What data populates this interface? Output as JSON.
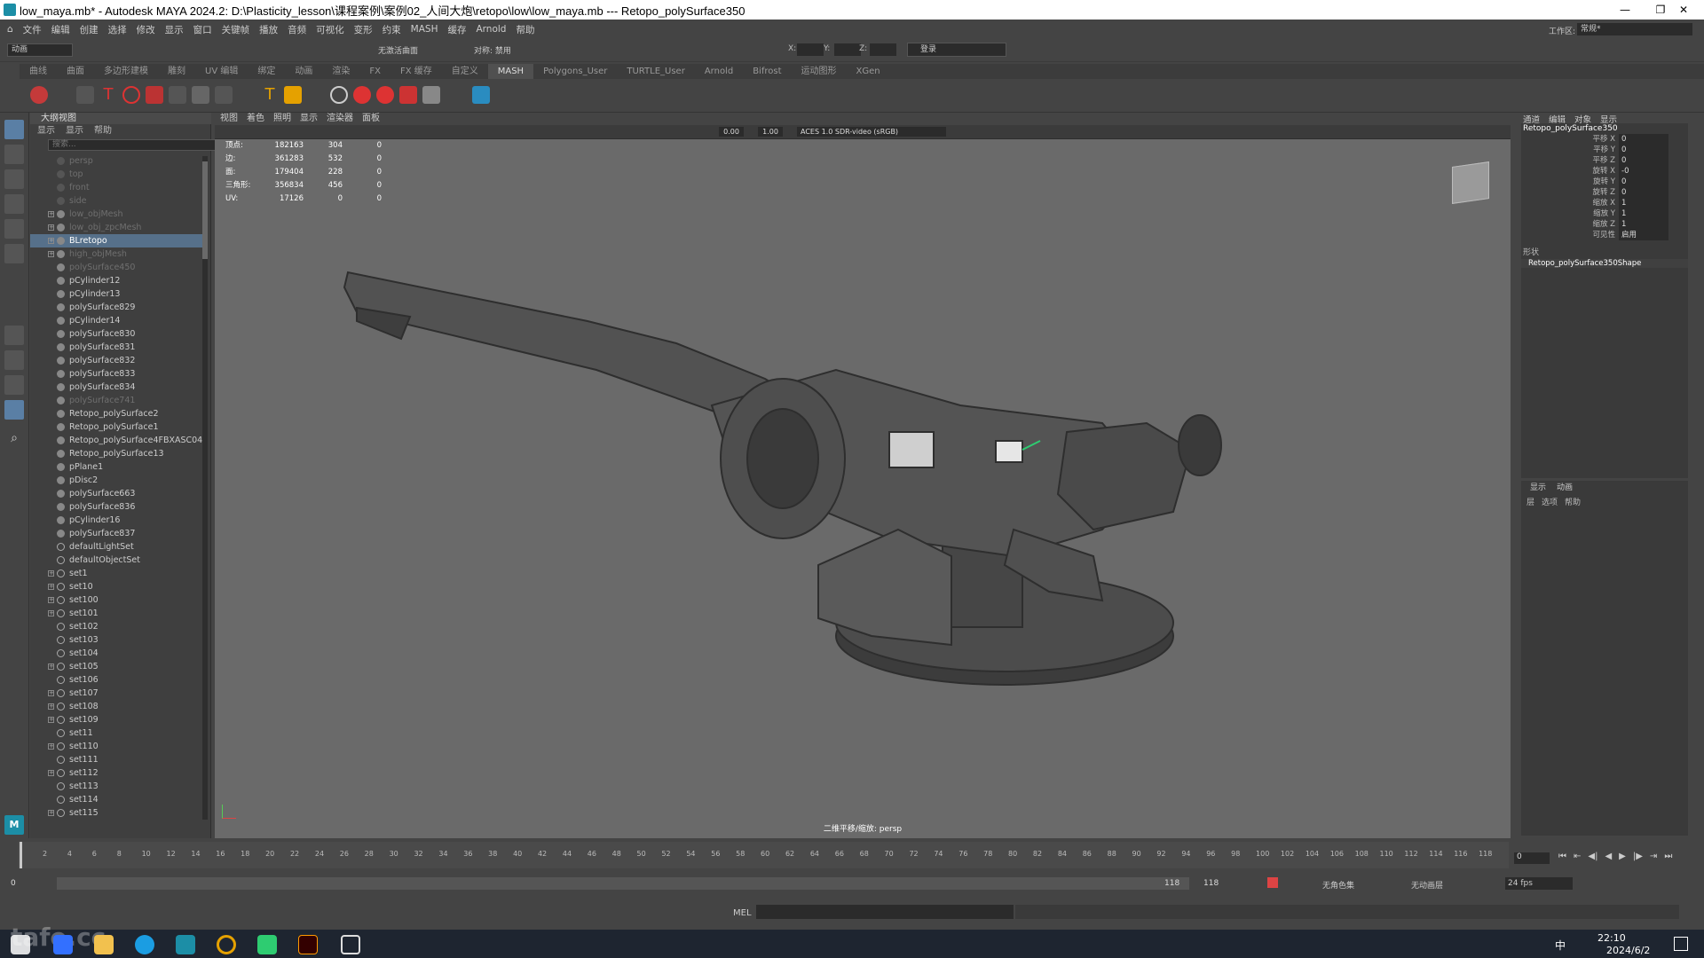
{
  "window": {
    "title": "low_maya.mb* - Autodesk MAYA 2024.2: D:\\Plasticity_lesson\\课程案例\\案例02_人间大炮\\retopo\\low\\low_maya.mb  ---  Retopo_polySurface350",
    "minimize": "—",
    "maximize": "❐",
    "close": "✕"
  },
  "menus": [
    "文件",
    "编辑",
    "创建",
    "选择",
    "修改",
    "显示",
    "窗口",
    "关键帧",
    "播放",
    "音频",
    "可视化",
    "变形",
    "约束",
    "MASH",
    "缓存",
    "Arnold",
    "帮助"
  ],
  "statusline": {
    "mode": "动画",
    "no_live": "无激活曲面",
    "symmetry": "对称: 禁用",
    "x_label": "X:",
    "y_label": "Y:",
    "z_label": "Z:",
    "login": "登录",
    "workspace_label": "工作区:",
    "workspace_value": "常规*"
  },
  "shelf_tabs": [
    "曲线",
    "曲面",
    "多边形建模",
    "雕刻",
    "UV 编辑",
    "绑定",
    "动画",
    "渲染",
    "FX",
    "FX 缓存",
    "自定义",
    "MASH",
    "Polygons_User",
    "TURTLE_User",
    "Arnold",
    "Bifrost",
    "运动图形",
    "XGen"
  ],
  "shelf_active": "MASH",
  "outliner": {
    "header": "大纲视图",
    "menu": [
      "显示",
      "显示",
      "帮助"
    ],
    "search_placeholder": "搜索...",
    "items": [
      {
        "label": "persp",
        "dim": true,
        "exp": false,
        "icon": "camera-icon"
      },
      {
        "label": "top",
        "dim": true,
        "exp": false,
        "icon": "camera-icon"
      },
      {
        "label": "front",
        "dim": true,
        "exp": false,
        "icon": "camera-icon"
      },
      {
        "label": "side",
        "dim": true,
        "exp": false,
        "icon": "camera-icon"
      },
      {
        "label": "low_objMesh",
        "dim": true,
        "exp": true,
        "icon": "mesh-icon"
      },
      {
        "label": "low_obj_zpcMesh",
        "dim": true,
        "exp": true,
        "icon": "mesh-icon"
      },
      {
        "label": "BLretopo",
        "sel": true,
        "exp": true,
        "icon": "mesh-icon"
      },
      {
        "label": "high_objMesh",
        "dim": true,
        "exp": true,
        "icon": "mesh-icon"
      },
      {
        "label": "polySurface450",
        "dim": true,
        "icon": "mesh-icon"
      },
      {
        "label": "pCylinder12",
        "icon": "mesh-icon"
      },
      {
        "label": "pCylinder13",
        "icon": "mesh-icon"
      },
      {
        "label": "polySurface829",
        "icon": "mesh-icon"
      },
      {
        "label": "pCylinder14",
        "icon": "mesh-icon"
      },
      {
        "label": "polySurface830",
        "icon": "mesh-icon"
      },
      {
        "label": "polySurface831",
        "icon": "mesh-icon"
      },
      {
        "label": "polySurface832",
        "icon": "mesh-icon"
      },
      {
        "label": "polySurface833",
        "icon": "mesh-icon"
      },
      {
        "label": "polySurface834",
        "icon": "mesh-icon"
      },
      {
        "label": "polySurface741",
        "dim": true,
        "icon": "mesh-icon"
      },
      {
        "label": "Retopo_polySurface2",
        "icon": "mesh-icon"
      },
      {
        "label": "Retopo_polySurface1",
        "icon": "mesh-icon"
      },
      {
        "label": "Retopo_polySurface4FBXASC0460",
        "icon": "mesh-icon"
      },
      {
        "label": "Retopo_polySurface13",
        "icon": "mesh-icon"
      },
      {
        "label": "pPlane1",
        "icon": "mesh-icon"
      },
      {
        "label": "pDisc2",
        "icon": "mesh-icon"
      },
      {
        "label": "polySurface663",
        "icon": "mesh-icon"
      },
      {
        "label": "polySurface836",
        "icon": "mesh-icon"
      },
      {
        "label": "pCylinder16",
        "icon": "mesh-icon"
      },
      {
        "label": "polySurface837",
        "icon": "mesh-icon"
      },
      {
        "label": "defaultLightSet",
        "icon": "set-icon"
      },
      {
        "label": "defaultObjectSet",
        "icon": "set-icon"
      },
      {
        "label": "set1",
        "exp": true,
        "icon": "set-icon"
      },
      {
        "label": "set10",
        "exp": true,
        "icon": "set-icon"
      },
      {
        "label": "set100",
        "exp": true,
        "icon": "set-icon"
      },
      {
        "label": "set101",
        "exp": true,
        "icon": "set-icon"
      },
      {
        "label": "set102",
        "icon": "set-icon"
      },
      {
        "label": "set103",
        "icon": "set-icon"
      },
      {
        "label": "set104",
        "icon": "set-icon"
      },
      {
        "label": "set105",
        "exp": true,
        "icon": "set-icon"
      },
      {
        "label": "set106",
        "icon": "set-icon"
      },
      {
        "label": "set107",
        "exp": true,
        "icon": "set-icon"
      },
      {
        "label": "set108",
        "exp": true,
        "icon": "set-icon"
      },
      {
        "label": "set109",
        "exp": true,
        "icon": "set-icon"
      },
      {
        "label": "set11",
        "icon": "set-icon"
      },
      {
        "label": "set110",
        "exp": true,
        "icon": "set-icon"
      },
      {
        "label": "set111",
        "icon": "set-icon"
      },
      {
        "label": "set112",
        "exp": true,
        "icon": "set-icon"
      },
      {
        "label": "set113",
        "icon": "set-icon"
      },
      {
        "label": "set114",
        "icon": "set-icon"
      },
      {
        "label": "set115",
        "exp": true,
        "icon": "set-icon"
      }
    ]
  },
  "viewport": {
    "menu": [
      "视图",
      "着色",
      "照明",
      "显示",
      "渲染器",
      "面板"
    ],
    "exposure": "0.00",
    "gamma": "1.00",
    "colorspace": "ACES 1.0 SDR-video (sRGB)",
    "camera_label": "二维平移/缩放: persp",
    "hud": [
      {
        "name": "顶点:",
        "a": "182163",
        "b": "304",
        "c": "0"
      },
      {
        "name": "边:",
        "a": "361283",
        "b": "532",
        "c": "0"
      },
      {
        "name": "面:",
        "a": "179404",
        "b": "228",
        "c": "0"
      },
      {
        "name": "三角形:",
        "a": "356834",
        "b": "456",
        "c": "0"
      },
      {
        "name": "UV:",
        "a": "17126",
        "b": "0",
        "c": "0"
      }
    ]
  },
  "channelbox": {
    "tabs": [
      "通道",
      "编辑",
      "对象",
      "显示"
    ],
    "object": "Retopo_polySurface350",
    "channels": [
      {
        "n": "平移 X",
        "v": "0"
      },
      {
        "n": "平移 Y",
        "v": "0"
      },
      {
        "n": "平移 Z",
        "v": "0"
      },
      {
        "n": "旋转 X",
        "v": "-0"
      },
      {
        "n": "旋转 Y",
        "v": "0"
      },
      {
        "n": "旋转 Z",
        "v": "0"
      },
      {
        "n": "缩放 X",
        "v": "1"
      },
      {
        "n": "缩放 Y",
        "v": "1"
      },
      {
        "n": "缩放 Z",
        "v": "1"
      },
      {
        "n": "可见性",
        "v": "启用"
      }
    ],
    "shapes_label": "形状",
    "shape": "Retopo_polySurface350Shape"
  },
  "layers": {
    "tabs": [
      "显示",
      "动画"
    ],
    "menu": [
      "层",
      "选项",
      "帮助"
    ]
  },
  "timeline": {
    "ticks": [
      "2",
      "4",
      "6",
      "8",
      "10",
      "12",
      "14",
      "16",
      "18",
      "20",
      "22",
      "24",
      "26",
      "28",
      "30",
      "32",
      "34",
      "36",
      "38",
      "40",
      "42",
      "44",
      "46",
      "48",
      "50",
      "52",
      "54",
      "56",
      "58",
      "60",
      "62",
      "64",
      "66",
      "68",
      "70",
      "72",
      "74",
      "76",
      "78",
      "80",
      "82",
      "84",
      "86",
      "88",
      "90",
      "92",
      "94",
      "96",
      "98",
      "100",
      "102",
      "104",
      "106",
      "108",
      "110",
      "112",
      "114",
      "116",
      "118"
    ],
    "current": "0"
  },
  "range": {
    "start": "0",
    "start2": "0",
    "end": "118",
    "end2": "118",
    "char_set": "无角色集",
    "anim_layer": "无动画层",
    "fps": "24 fps"
  },
  "cmd": {
    "lang": "MEL"
  },
  "taskbar": {
    "time": "22:10",
    "date": "2024/6/2",
    "ime": "中",
    "watermark": "tafe.cc"
  },
  "colors": {
    "accent": "#56708a",
    "viewport": "#6a6a6a",
    "panel": "#444444"
  }
}
